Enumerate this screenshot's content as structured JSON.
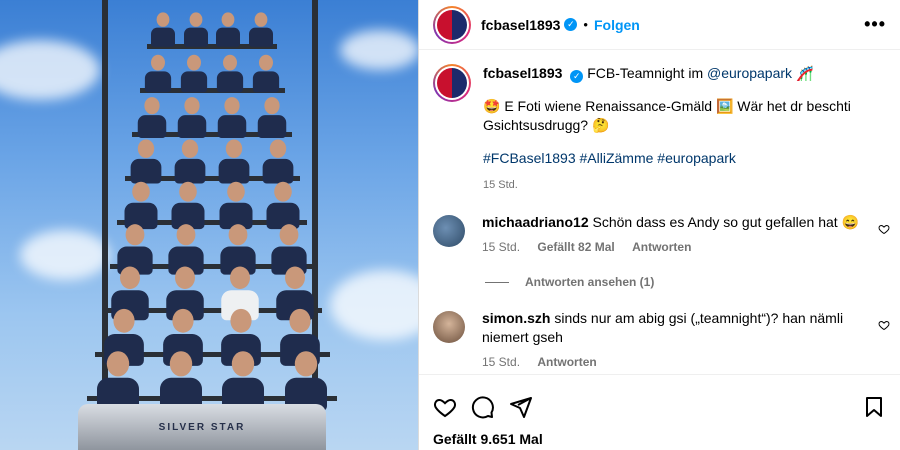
{
  "post": {
    "username": "fcbasel1893",
    "follow_label": "Folgen",
    "more_label": "•••",
    "verified_mark": "✓",
    "separator": "•"
  },
  "caption": {
    "username": "fcbasel1893",
    "line1_text": "FCB-Teamnight im ",
    "mention": "@europapark",
    "line1_emoji": "🎢",
    "line2_emoji_start": "🤩",
    "line2_text": " E Foti wiene Renaissance-Gmäld ",
    "line2_emoji_mid": "🖼️",
    "line2_text_end": " Wär het dr beschti Gsichtsusdrugg? ",
    "line2_emoji_end": "🤔",
    "hashtags": "#FCBasel1893 #AlliZämme #europapark",
    "time": "15 Std."
  },
  "comments": [
    {
      "username": "michaadriano12",
      "text": "Schön dass es Andy so gut gefallen hat 😄",
      "time": "15 Std.",
      "likes": "Gefällt 82 Mal",
      "reply": "Antworten",
      "view_replies": "Antworten ansehen (1)",
      "avatar_color": "#4b6a8c"
    },
    {
      "username": "simon.szh",
      "text": "sinds nur am abig gsi („teamnight“)? han nämli niemert gseh",
      "time": "15 Std.",
      "reply": "Antworten",
      "avatar_color": "#a07d62"
    }
  ],
  "footer": {
    "likes_label": "Gefällt 9.651 Mal"
  },
  "photo": {
    "coaster_text": "SILVER STAR"
  },
  "colors": {
    "accent": "#0095f6",
    "fcb_red": "#c8102e",
    "fcb_blue": "#1d2a6b"
  },
  "icons": [
    "verified-icon",
    "more-options-icon",
    "heart-icon",
    "comment-icon",
    "share-icon",
    "bookmark-icon"
  ]
}
